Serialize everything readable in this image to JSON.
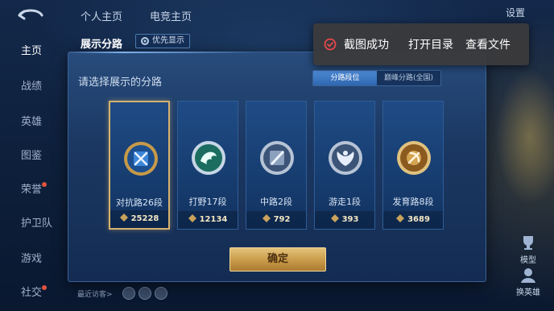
{
  "top_nav": {
    "tabs": [
      "个人主页",
      "电竞主页"
    ],
    "settings_label": "设置"
  },
  "left_nav": {
    "items": [
      {
        "label": "主页",
        "active": true
      },
      {
        "label": "战绩",
        "active": false
      },
      {
        "label": "英雄",
        "active": false
      },
      {
        "label": "图鉴",
        "active": false
      },
      {
        "label": "荣誉",
        "active": false
      },
      {
        "label": "护卫队",
        "active": false
      },
      {
        "label": "游戏",
        "active": false
      },
      {
        "label": "社交",
        "active": false
      }
    ]
  },
  "right_buttons": {
    "model_label": "模型",
    "switch_hero_label": "换英雄"
  },
  "modal": {
    "title": "展示分路",
    "priority_chip": "优先显示",
    "instruction": "请选择展示的分路",
    "tabs": [
      {
        "label": "分路段位",
        "active": true
      },
      {
        "label": "巅峰分路(全国)",
        "active": false
      }
    ],
    "lanes": [
      {
        "name": "对抗路26段",
        "score": "25228",
        "selected": true,
        "emblem_color": "#3c86d8",
        "icon": "sword-cross-icon"
      },
      {
        "name": "打野17段",
        "score": "12134",
        "selected": false,
        "emblem_color": "#2fae82",
        "icon": "dragon-icon"
      },
      {
        "name": "中路2段",
        "score": "792",
        "selected": false,
        "emblem_color": "#8aa0bd",
        "icon": "staff-icon"
      },
      {
        "name": "游走1段",
        "score": "393",
        "selected": false,
        "emblem_color": "#8aa0bd",
        "icon": "wings-icon"
      },
      {
        "name": "发育路8段",
        "score": "3689",
        "selected": false,
        "emblem_color": "#d4a552",
        "icon": "bow-icon"
      }
    ],
    "confirm_label": "确定"
  },
  "toast": {
    "message": "截图成功",
    "open_dir": "打开目录",
    "view_file": "查看文件"
  },
  "bottom": {
    "recent_visitors": "最近访客>"
  },
  "colors": {
    "accent_gold": "#d6b36e",
    "tab_active": "#3f7cc8",
    "toast_check": "#e5484d"
  }
}
